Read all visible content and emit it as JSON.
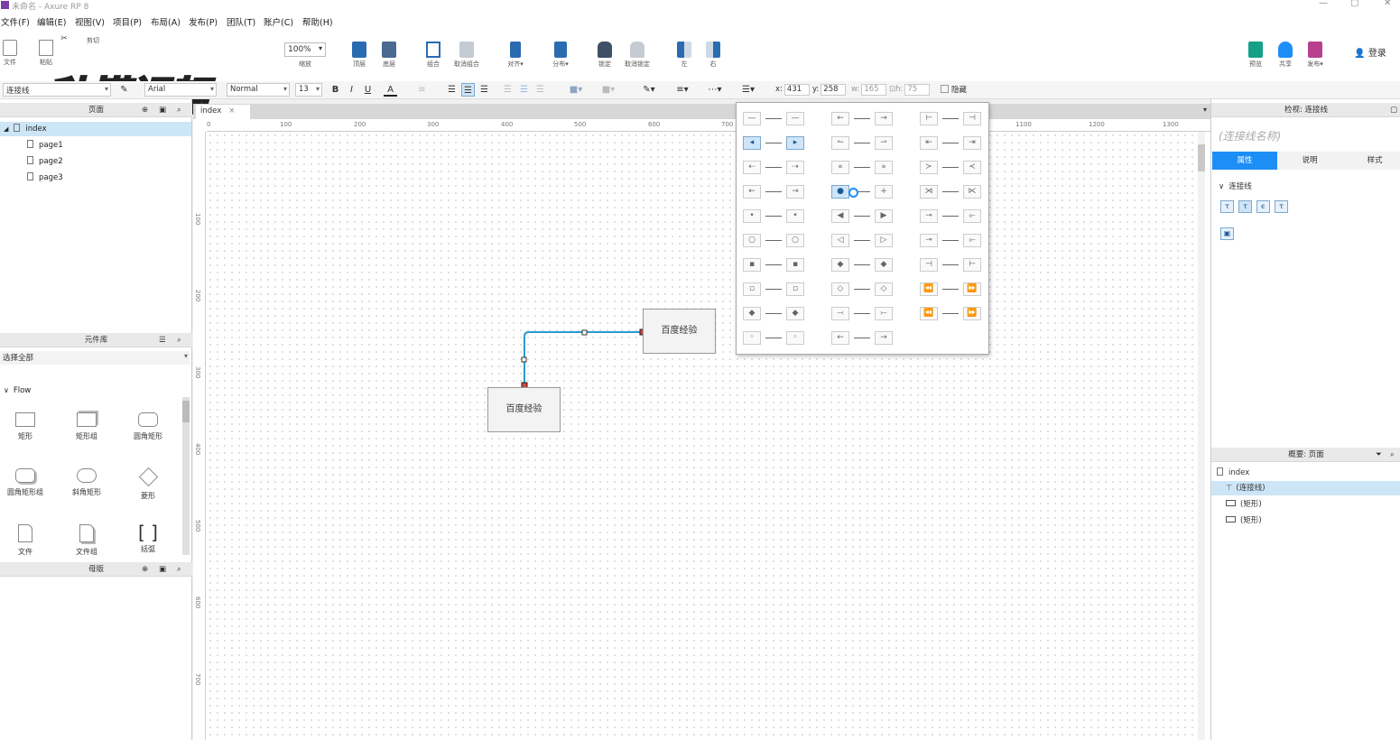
{
  "window": {
    "title": "未命名 - Axure RP 8",
    "controls": [
      "—",
      "▢",
      "✕"
    ]
  },
  "menu": [
    "文件(F)",
    "编辑(E)",
    "视图(V)",
    "项目(P)",
    "布局(A)",
    "发布(P)",
    "团队(T)",
    "账户(C)",
    "帮助(H)"
  ],
  "toolbar": {
    "file_label": "文件",
    "paste_label": "粘贴",
    "cut_label": "剪切",
    "zoom_value": "100%",
    "zoom_label": "缩放",
    "top_label": "顶层",
    "bottom_label": "底层",
    "group_label": "组合",
    "ungroup_label": "取消组合",
    "align_label": "对齐▾",
    "distribute_label": "分布▾",
    "lock_label": "锁定",
    "unlock_label": "取消锁定",
    "left_label": "左",
    "right_label": "右",
    "preview_label": "预览",
    "share_label": "共享",
    "publish_label": "发布▾",
    "login_label": "登录",
    "watermark": "秒懂视频"
  },
  "format": {
    "widget_type": "连接线",
    "font_family": "Arial",
    "font_style": "Normal",
    "font_size": "13",
    "x_label": "x:",
    "x": "431",
    "y_label": "y:",
    "y": "258",
    "w_label": "w:",
    "w": "165",
    "h_label": "h:",
    "h": "75",
    "hidden_label": "隐藏"
  },
  "pages_panel": {
    "title": "页面",
    "root": "index",
    "pages": [
      "page1",
      "page2",
      "page3"
    ]
  },
  "library_panel": {
    "title": "元件库",
    "filter": "选择全部",
    "group": "Flow",
    "widgets": [
      "矩形",
      "矩形组",
      "圆角矩形",
      "圆角矩形组",
      "斜角矩形",
      "菱形",
      "文件",
      "文件组",
      "括弧"
    ]
  },
  "masters_panel": {
    "title": "母版"
  },
  "canvas": {
    "tab": "index",
    "hruler": [
      "0",
      "100",
      "200",
      "300",
      "400",
      "500",
      "600",
      "700",
      "1100",
      "1200",
      "1300"
    ],
    "vruler": [
      "100",
      "200",
      "300",
      "400",
      "500",
      "600",
      "700"
    ],
    "box1": "百度经验",
    "box2": "百度经验"
  },
  "inspector": {
    "title": "检视: 连接线",
    "name_placeholder": "(连接线名称)",
    "tabs": [
      "属性",
      "说明",
      "样式"
    ],
    "section": "连接线"
  },
  "outline": {
    "title": "概要: 页面",
    "root": "index",
    "items": [
      "(连接线)",
      "(矩形)",
      "(矩形)"
    ]
  },
  "colors": {
    "accent": "#1e8ef7",
    "connector": "#2a9bd1",
    "selection": "#cfe5f7"
  }
}
